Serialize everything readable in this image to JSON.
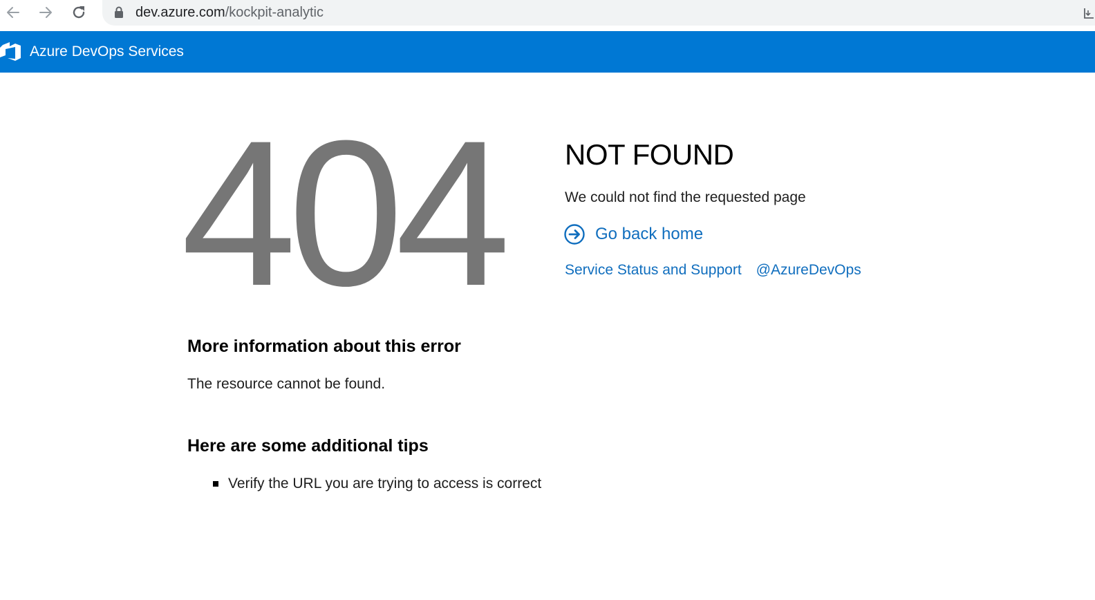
{
  "browser": {
    "url_host": "dev.azure.com",
    "url_path": "/kockpit-analytic",
    "icons": {
      "back": "back-arrow-icon",
      "forward": "forward-arrow-icon",
      "reload": "reload-icon",
      "lock": "lock-icon",
      "install": "install-app-icon"
    }
  },
  "header": {
    "title": "Azure DevOps Services",
    "logo_icon": "azure-devops-logo-icon",
    "background_color": "#0078d4"
  },
  "error": {
    "code": "404",
    "title": "NOT FOUND",
    "description": "We could not find the requested page",
    "home_link_label": "Go back home",
    "home_link_icon": "arrow-right-circle-icon",
    "links": {
      "status_support": "Service Status and Support",
      "twitter": "@AzureDevOps"
    },
    "link_color": "#106ebe",
    "code_color": "#767676"
  },
  "more_info": {
    "heading": "More information about this error",
    "text": "The resource cannot be found."
  },
  "tips": {
    "heading": "Here are some additional tips",
    "items": [
      "Verify the URL you are trying to access is correct"
    ]
  }
}
